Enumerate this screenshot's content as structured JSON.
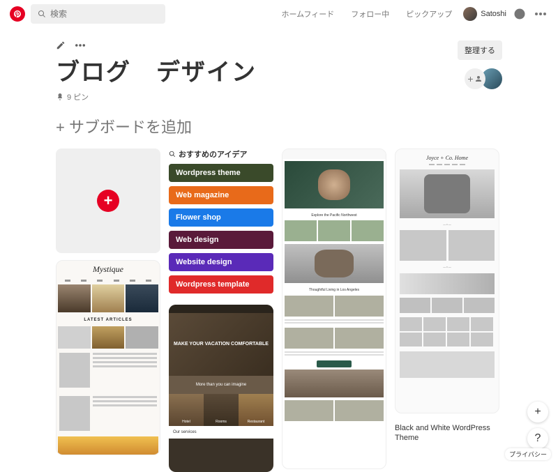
{
  "header": {
    "search_placeholder": "検索",
    "nav": {
      "home": "ホームフィード",
      "following": "フォロー中",
      "pickup": "ピックアップ"
    },
    "user_name": "Satoshi"
  },
  "board": {
    "title": "ブログ　デザイン",
    "pin_count_label": "9 ピン",
    "organize_label": "整理する",
    "add_subboard_label": "+ サブボードを追加"
  },
  "ideas": {
    "header": "おすすめのアイデア",
    "chips": [
      {
        "label": "Wordpress theme",
        "color": "#3a4a2a"
      },
      {
        "label": "Web magazine",
        "color": "#e86a1a"
      },
      {
        "label": "Flower shop",
        "color": "#1a7ae8"
      },
      {
        "label": "Web design",
        "color": "#5a1a3a"
      },
      {
        "label": "Website design",
        "color": "#5a2ab8"
      },
      {
        "label": "Wordpress template",
        "color": "#e02a2a"
      }
    ]
  },
  "pins": {
    "mystique": {
      "logo": "Mystique",
      "section": "LATEST ARTICLES"
    },
    "vacation": {
      "headline": "MAKE YOUR VACATION COMFORTABLE",
      "strip": "More than you can imagine",
      "tiles": [
        "Hotel",
        "Rooms",
        "Restaurant"
      ],
      "services": "Our services"
    },
    "mag": {
      "cap1": "Explore the Pacific Northwest",
      "cap2": "Thoughtful Living in Los Angeles"
    },
    "bw": {
      "logo": "Joyce + Co. Home",
      "title": "Black and White WordPress Theme"
    }
  },
  "footer": {
    "privacy": "プライバシー"
  }
}
